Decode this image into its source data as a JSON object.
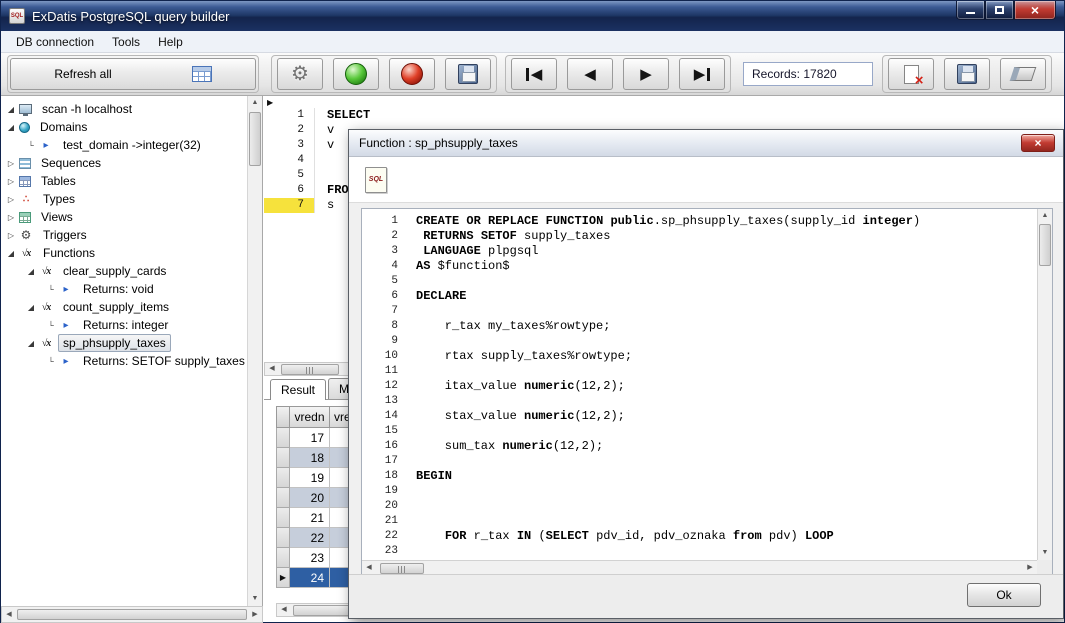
{
  "window": {
    "title": "ExDatis PostgreSQL query builder",
    "menu": [
      "DB connection",
      "Tools",
      "Help"
    ]
  },
  "toolbar": {
    "refresh_label": "Refresh all",
    "records_value": "Records: 17820"
  },
  "tree": {
    "items": [
      {
        "label": "scan -h localhost",
        "icon": "computer-icon",
        "level": 0,
        "marker": "expanded"
      },
      {
        "label": "Domains",
        "icon": "domain-icon",
        "level": 0,
        "marker": "expanded"
      },
      {
        "label": "test_domain ->integer(32)",
        "icon": "arrow-icon",
        "level": 1,
        "marker": "leaf"
      },
      {
        "label": "Sequences",
        "icon": "sequence-icon",
        "level": 0,
        "marker": "collapsed"
      },
      {
        "label": "Tables",
        "icon": "table-icon",
        "level": 0,
        "marker": "collapsed"
      },
      {
        "label": "Types",
        "icon": "type-icon",
        "level": 0,
        "marker": "collapsed"
      },
      {
        "label": "Views",
        "icon": "view-icon",
        "level": 0,
        "marker": "collapsed"
      },
      {
        "label": "Triggers",
        "icon": "trigger-icon",
        "level": 0,
        "marker": "collapsed"
      },
      {
        "label": "Functions",
        "icon": "function-icon",
        "level": 0,
        "marker": "expanded"
      },
      {
        "label": "clear_supply_cards",
        "icon": "function-icon",
        "level": 1,
        "marker": "expanded"
      },
      {
        "label": "Returns: void",
        "icon": "arrow-icon",
        "level": 2,
        "marker": "leaf"
      },
      {
        "label": "count_supply_items",
        "icon": "function-icon",
        "level": 1,
        "marker": "expanded"
      },
      {
        "label": "Returns: integer",
        "icon": "arrow-icon",
        "level": 2,
        "marker": "leaf"
      },
      {
        "label": "sp_phsupply_taxes",
        "icon": "function-icon",
        "level": 1,
        "marker": "expanded",
        "selected": true
      },
      {
        "label": "Returns: SETOF supply_taxes",
        "icon": "arrow-icon",
        "level": 2,
        "marker": "leaf"
      }
    ]
  },
  "editor": {
    "lines": [
      {
        "n": 1,
        "text": "SELECT"
      },
      {
        "n": 2,
        "text": "v"
      },
      {
        "n": 3,
        "text": "v"
      },
      {
        "n": 4,
        "text": ""
      },
      {
        "n": 5,
        "text": ""
      },
      {
        "n": 6,
        "text": "FRO"
      },
      {
        "n": 7,
        "text": "s",
        "marker": true
      }
    ]
  },
  "results": {
    "tabs": [
      "Result",
      "Mes"
    ],
    "columns": [
      "vredn",
      "vred"
    ],
    "rows": [
      "17",
      "18",
      "19",
      "20",
      "21",
      "22",
      "23",
      "24"
    ],
    "selected_row": "24"
  },
  "dialog": {
    "title": "Function : sp_phsupply_taxes",
    "sql_icon_label": "SQL",
    "ok_label": "Ok",
    "code_lines": [
      "CREATE OR REPLACE FUNCTION public.sp_phsupply_taxes(supply_id integer)",
      " RETURNS SETOF supply_taxes",
      " LANGUAGE plpgsql",
      "AS $function$",
      "",
      "DECLARE",
      "",
      "    r_tax my_taxes%rowtype;",
      "",
      "    rtax supply_taxes%rowtype;",
      "",
      "    itax_value numeric(12,2);",
      "",
      "    stax_value numeric(12,2);",
      "",
      "    sum_tax numeric(12,2);",
      "",
      "BEGIN",
      "",
      "",
      "",
      "    FOR r_tax IN (SELECT pdv_id, pdv_oznaka from pdv) LOOP",
      ""
    ]
  },
  "sql_keywords": [
    "CREATE",
    "REPLACE",
    "FUNCTION",
    "RETURNS",
    "SETOF",
    "LANGUAGE",
    "DECLARE",
    "BEGIN",
    "SELECT",
    "LOOP",
    "FOR",
    "FRO",
    "OR",
    "IN",
    "AS",
    "from",
    "numeric",
    "public",
    "integer"
  ],
  "colors": {
    "selection-blue": "#2e5fa3",
    "marker-yellow": "#f6e23c",
    "alt-row": "#c6cedb",
    "close-red": "#c23b32",
    "titlebar-blue": "#1e3766"
  }
}
